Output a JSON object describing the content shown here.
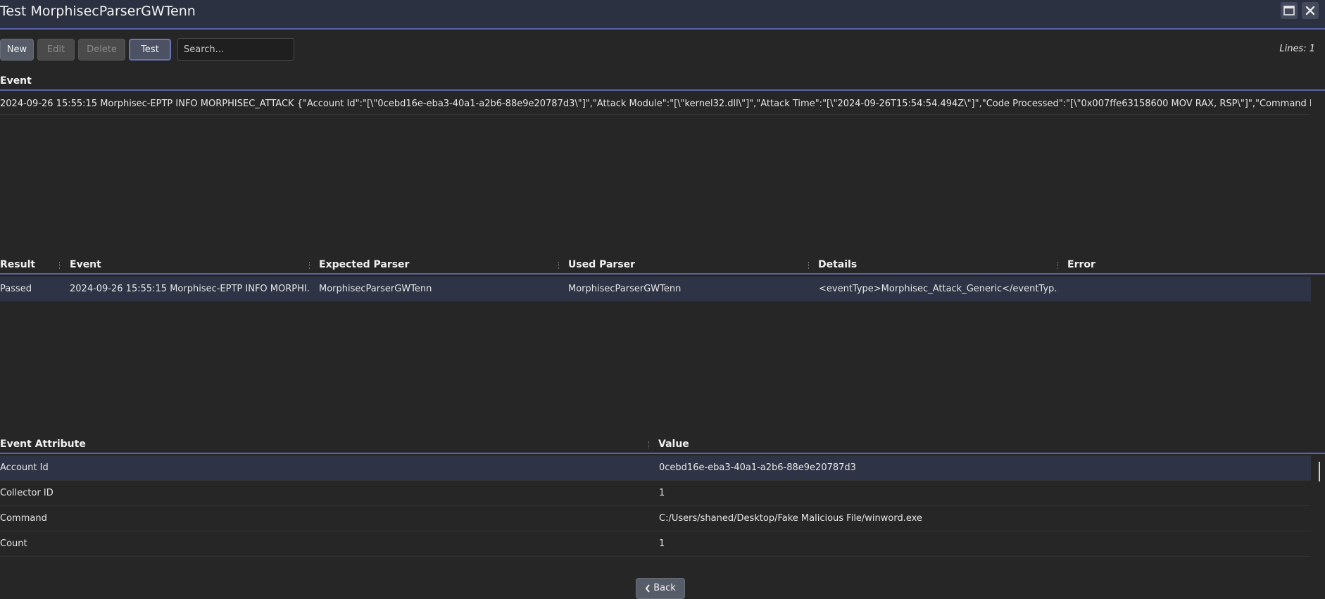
{
  "window": {
    "title": "Test MorphisecParserGWTenn"
  },
  "toolbar": {
    "new_label": "New",
    "edit_label": "Edit",
    "delete_label": "Delete",
    "test_label": "Test",
    "search_placeholder": "Search...",
    "lines_label": "Lines: 1"
  },
  "event_section": {
    "header": "Event",
    "line": "2024-09-26 15:55:15 Morphisec-EPTP INFO MORPHISEC_ATTACK {\"Account Id\":\"[\\\"0cebd16e-eba3-40a1-a2b6-88e9e20787d3\\\"]\",\"Attack Module\":\"[\\\"kernel32.dll\\\"]\",\"Attack Time\":\"[\\\"2024-09-26T15:54:54.494Z\\\"]\",\"Code Processed\":\"[\\\"0x007ffe63158600 MOV RAX, RSP\\\"]\",\"Command Line\":\"..."
  },
  "results_table": {
    "columns": [
      "Result",
      "Event",
      "Expected Parser",
      "Used Parser",
      "Details",
      "Error"
    ],
    "rows": [
      {
        "result": "Passed",
        "event": "2024-09-26 15:55:15 Morphisec-EPTP INFO MORPHI...",
        "expected_parser": "MorphisecParserGWTenn",
        "used_parser": "MorphisecParserGWTenn",
        "details": "<eventType>Morphisec_Attack_Generic</eventTyp...",
        "error": ""
      }
    ]
  },
  "attributes_table": {
    "columns": [
      "Event Attribute",
      "Value"
    ],
    "rows": [
      {
        "attribute": "Account Id",
        "value": "0cebd16e-eba3-40a1-a2b6-88e9e20787d3"
      },
      {
        "attribute": "Collector ID",
        "value": "1"
      },
      {
        "attribute": "Command",
        "value": "C:/Users/shaned/Desktop/Fake Malicious File/winword.exe"
      },
      {
        "attribute": "Count",
        "value": "1"
      }
    ]
  },
  "footer": {
    "back_label": "Back"
  }
}
